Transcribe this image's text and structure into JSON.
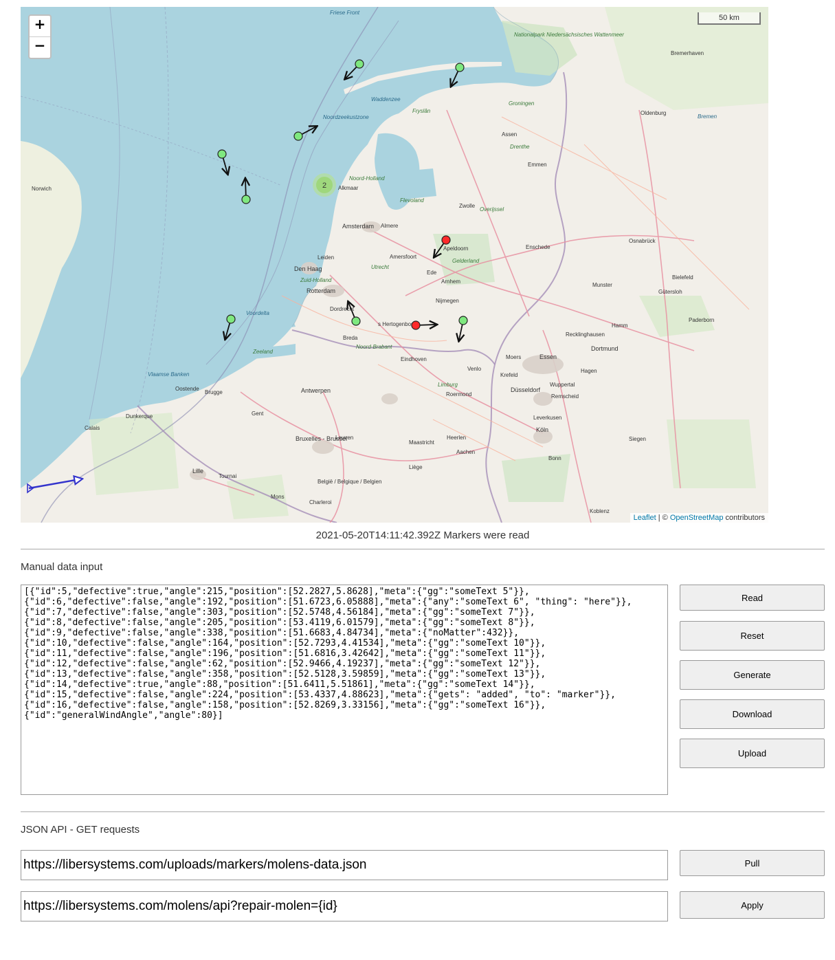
{
  "map": {
    "zoom_in_label": "+",
    "zoom_out_label": "−",
    "scale_label": "50 km",
    "attribution": {
      "leaflet": "Leaflet",
      "separator": " | © ",
      "osm": "OpenStreetMap",
      "suffix": " contributors"
    },
    "cluster_count": "2",
    "colors": {
      "sea": "#aad3df",
      "land": "#f2efe9",
      "marker_ok": "#7fe87f",
      "marker_defective": "#ff2b2b",
      "cluster": "#9fd77d",
      "wind_arrow": "#3333cc"
    },
    "place_labels": [
      "Friese Front",
      "Nationalpark Niedersächsisches Wattenmeer",
      "Bremerhaven",
      "Waddenzee",
      "Groningen",
      "Fryslân",
      "Oldenburg",
      "Bremen",
      "Assen",
      "Drenthe",
      "Emmen",
      "Noordzeekustzone",
      "Noord-Holland",
      "Norwich",
      "Alkmaar",
      "Flevoland",
      "Zwolle",
      "Overijssel",
      "Amsterdam",
      "Almere",
      "Apeldoorn",
      "Enschede",
      "Osnabrück",
      "Leiden",
      "Amersfoort",
      "Gelderland",
      "Den Haag",
      "Utrecht",
      "Zuid-Holland",
      "Ede",
      "Arnhem",
      "Bielefeld",
      "Munster",
      "Rotterdam",
      "Gütersloh",
      "Nijmegen",
      "Voordelta",
      "Dordrecht",
      "s Hertogenbosch",
      "Hamm",
      "Paderborn",
      "Breda",
      "Noord-Brabant",
      "Recklinghausen",
      "Dortmund",
      "Zeeland",
      "Eindhoven",
      "Venlo",
      "Essen",
      "Vlaamse Banken",
      "Moers",
      "Krefeld",
      "Hagen",
      "Oostende",
      "Brugge",
      "Antwerpen",
      "Limburg",
      "Roermond",
      "Düsseldorf",
      "Wuppertal",
      "Remscheid",
      "Dunkerque",
      "Gent",
      "Leverkusen",
      "Köln",
      "Calais",
      "Bruxelles - Brussel",
      "Leuven",
      "Maastricht",
      "Heerlen",
      "Siegen",
      "Aachen",
      "Lille",
      "Tournai",
      "Mons",
      "Liège",
      "Bonn",
      "België / Belgique / Belgien",
      "Charleroi",
      "Koblenz"
    ]
  },
  "status": "2021-05-20T14:11:42.392Z Markers were read",
  "manual": {
    "heading": "Manual data input",
    "text": "[{\"id\":5,\"defective\":true,\"angle\":215,\"position\":[52.2827,5.8628],\"meta\":{\"gg\":\"someText 5\"}},\n{\"id\":6,\"defective\":false,\"angle\":192,\"position\":[51.6723,6.05888],\"meta\":{\"any\":\"someText 6\", \"thing\": \"here\"}},\n{\"id\":7,\"defective\":false,\"angle\":303,\"position\":[52.5748,4.56184],\"meta\":{\"gg\":\"someText 7\"}},\n{\"id\":8,\"defective\":false,\"angle\":205,\"position\":[53.4119,6.01579],\"meta\":{\"gg\":\"someText 8\"}},\n{\"id\":9,\"defective\":false,\"angle\":338,\"position\":[51.6683,4.84734],\"meta\":{\"noMatter\":432}},\n{\"id\":10,\"defective\":false,\"angle\":164,\"position\":[52.7293,4.41534],\"meta\":{\"gg\":\"someText 10\"}},\n{\"id\":11,\"defective\":false,\"angle\":196,\"position\":[51.6816,3.42642],\"meta\":{\"gg\":\"someText 11\"}},\n{\"id\":12,\"defective\":false,\"angle\":62,\"position\":[52.9466,4.19237],\"meta\":{\"gg\":\"someText 12\"}},\n{\"id\":13,\"defective\":false,\"angle\":358,\"position\":[52.5128,3.59859],\"meta\":{\"gg\":\"someText 13\"}},\n{\"id\":14,\"defective\":true,\"angle\":88,\"position\":[51.6411,5.51861],\"meta\":{\"gg\":\"someText 14\"}},\n{\"id\":15,\"defective\":false,\"angle\":224,\"position\":[53.4337,4.88623],\"meta\":{\"gets\": \"added\", \"to\": \"marker\"}},\n{\"id\":16,\"defective\":false,\"angle\":158,\"position\":[52.8269,3.33156],\"meta\":{\"gg\":\"someText 16\"}},\n{\"id\":\"generalWindAngle\",\"angle\":80}]",
    "buttons": {
      "read": "Read",
      "reset": "Reset",
      "generate": "Generate",
      "download": "Download",
      "upload": "Upload"
    }
  },
  "api": {
    "heading": "JSON API - GET requests",
    "pull_url": "https://libersystems.com/uploads/markers/molens-data.json",
    "apply_url": "https://libersystems.com/molens/api?repair-molen={id}",
    "pull_label": "Pull",
    "apply_label": "Apply"
  }
}
